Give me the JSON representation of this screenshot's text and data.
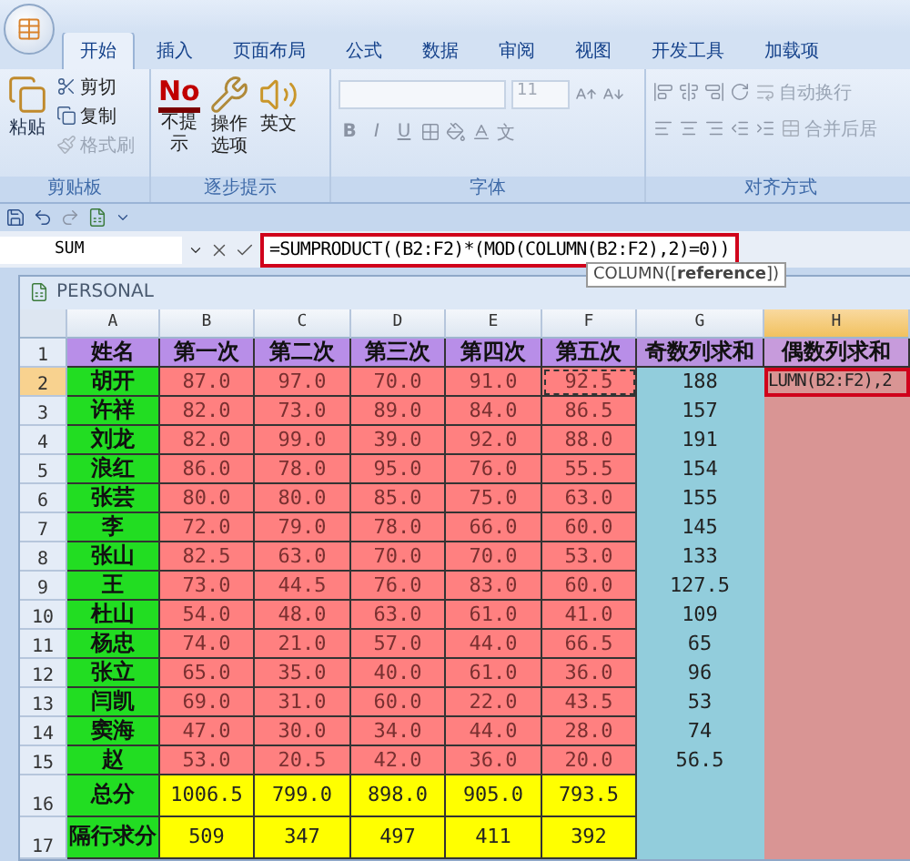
{
  "ribbon_tabs": [
    {
      "label": "开始",
      "selected": true
    },
    {
      "label": "插入",
      "selected": false
    },
    {
      "label": "页面布局",
      "selected": false
    },
    {
      "label": "公式",
      "selected": false
    },
    {
      "label": "数据",
      "selected": false
    },
    {
      "label": "审阅",
      "selected": false
    },
    {
      "label": "视图",
      "selected": false
    },
    {
      "label": "开发工具",
      "selected": false
    },
    {
      "label": "加载项",
      "selected": false
    }
  ],
  "clipboard": {
    "title": "剪贴板",
    "paste": "粘贴",
    "small": [
      {
        "label": "剪切",
        "disabled": false
      },
      {
        "label": "复制",
        "disabled": false
      },
      {
        "label": "格式刷",
        "disabled": true
      }
    ]
  },
  "steps": {
    "title": "逐步提示",
    "badge": "No",
    "buttons": [
      {
        "kind": "no",
        "label": "不提示"
      },
      {
        "kind": "options",
        "label": "操作选项"
      },
      {
        "kind": "speaker",
        "label": "英文"
      }
    ]
  },
  "font": {
    "title": "字体",
    "size": "11",
    "format_buttons": [
      "B",
      "I",
      "U"
    ],
    "phonetic": "文"
  },
  "alignment": {
    "title": "对齐方式",
    "commands": [
      "自动换行",
      "合并后居"
    ]
  },
  "formula_bar": {
    "name_box": "SUM",
    "formula": "=SUMPRODUCT((B2:F2)*(MOD(COLUMN(B2:F2),2)=0))",
    "tooltip": "COLUMN([**reference**])"
  },
  "workbook": {
    "title": "PERSONAL"
  },
  "columns": [
    {
      "letter": "A",
      "selected": false
    },
    {
      "letter": "B",
      "selected": false
    },
    {
      "letter": "C",
      "selected": false
    },
    {
      "letter": "D",
      "selected": false
    },
    {
      "letter": "E",
      "selected": false
    },
    {
      "letter": "F",
      "selected": false
    },
    {
      "letter": "G",
      "selected": false
    },
    {
      "letter": "H",
      "selected": true
    }
  ],
  "rows": [
    {
      "number": "1",
      "kind": "header",
      "selected": false,
      "cells": [
        "姓名",
        "第一次",
        "第二次",
        "第三次",
        "第四次",
        "第五次",
        "奇数列求和",
        "偶数列求和"
      ]
    },
    {
      "number": "2",
      "kind": "score",
      "selected": true,
      "cells": [
        "胡开",
        "87.0",
        "97.0",
        "70.0",
        "91.0",
        "92.5",
        "188",
        "LUMN(B2:F2),2"
      ]
    },
    {
      "number": "3",
      "kind": "score",
      "selected": false,
      "cells": [
        "许祥",
        "82.0",
        "73.0",
        "89.0",
        "84.0",
        "86.5",
        "157",
        ""
      ]
    },
    {
      "number": "4",
      "kind": "score",
      "selected": false,
      "cells": [
        "刘龙",
        "82.0",
        "99.0",
        "39.0",
        "92.0",
        "88.0",
        "191",
        ""
      ]
    },
    {
      "number": "5",
      "kind": "score",
      "selected": false,
      "cells": [
        "浪红",
        "86.0",
        "78.0",
        "95.0",
        "76.0",
        "55.5",
        "154",
        ""
      ]
    },
    {
      "number": "6",
      "kind": "score",
      "selected": false,
      "cells": [
        "张芸",
        "80.0",
        "80.0",
        "85.0",
        "75.0",
        "63.0",
        "155",
        ""
      ]
    },
    {
      "number": "7",
      "kind": "score",
      "selected": false,
      "cells": [
        "李",
        "72.0",
        "79.0",
        "78.0",
        "66.0",
        "60.0",
        "145",
        ""
      ]
    },
    {
      "number": "8",
      "kind": "score",
      "selected": false,
      "cells": [
        "张山",
        "82.5",
        "63.0",
        "70.0",
        "70.0",
        "53.0",
        "133",
        ""
      ]
    },
    {
      "number": "9",
      "kind": "score",
      "selected": false,
      "cells": [
        "王",
        "73.0",
        "44.5",
        "76.0",
        "83.0",
        "60.0",
        "127.5",
        ""
      ]
    },
    {
      "number": "10",
      "kind": "score",
      "selected": false,
      "cells": [
        "杜山",
        "54.0",
        "48.0",
        "63.0",
        "61.0",
        "41.0",
        "109",
        ""
      ]
    },
    {
      "number": "11",
      "kind": "score",
      "selected": false,
      "cells": [
        "杨忠",
        "74.0",
        "21.0",
        "57.0",
        "44.0",
        "66.5",
        "65",
        ""
      ]
    },
    {
      "number": "12",
      "kind": "score",
      "selected": false,
      "cells": [
        "张立",
        "65.0",
        "35.0",
        "40.0",
        "61.0",
        "36.0",
        "96",
        ""
      ]
    },
    {
      "number": "13",
      "kind": "score",
      "selected": false,
      "cells": [
        "闫凯",
        "69.0",
        "31.0",
        "60.0",
        "22.0",
        "43.5",
        "53",
        ""
      ]
    },
    {
      "number": "14",
      "kind": "score",
      "selected": false,
      "cells": [
        "窦海",
        "47.0",
        "30.0",
        "34.0",
        "44.0",
        "28.0",
        "74",
        ""
      ]
    },
    {
      "number": "15",
      "kind": "score",
      "selected": false,
      "cells": [
        "赵",
        "53.0",
        "20.5",
        "42.0",
        "36.0",
        "20.0",
        "56.5",
        ""
      ]
    },
    {
      "number": "16",
      "kind": "total",
      "selected": false,
      "cells": [
        "总分",
        "1006.5",
        "799.0",
        "898.0",
        "905.0",
        "793.5",
        "",
        ""
      ]
    },
    {
      "number": "17",
      "kind": "total",
      "selected": false,
      "cells": [
        "隔行求分",
        "509",
        "347",
        "497",
        "411",
        "392",
        "",
        ""
      ]
    }
  ]
}
